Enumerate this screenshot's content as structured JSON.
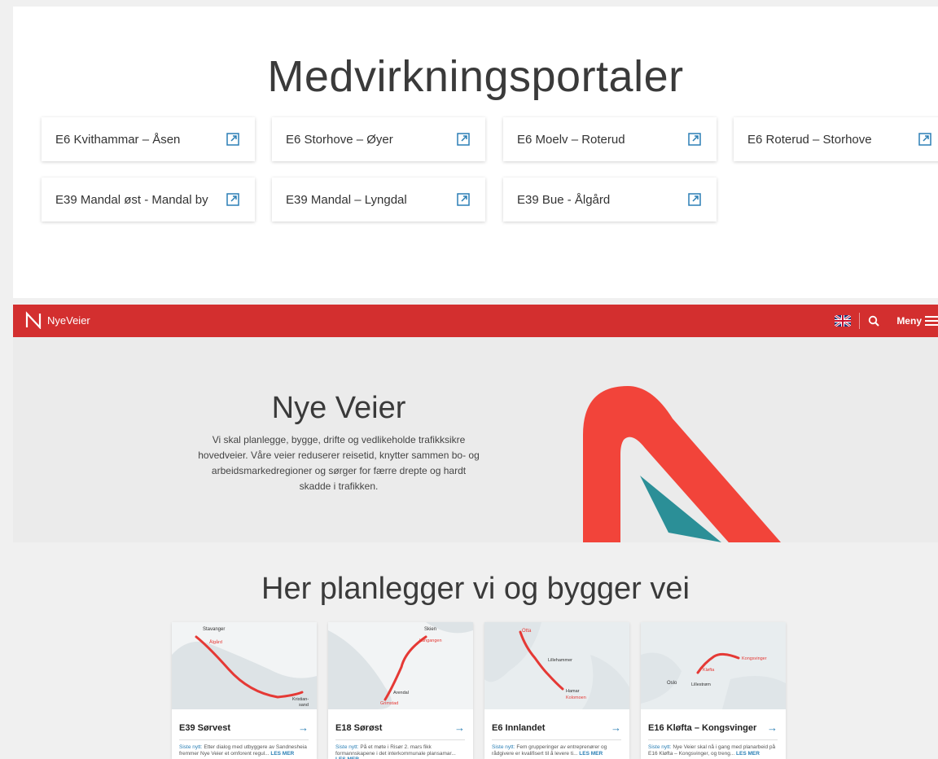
{
  "portals": {
    "title": "Medvirkningsportaler",
    "items": [
      {
        "label": "E6 Kvithammar – Åsen"
      },
      {
        "label": "E6 Storhove – Øyer"
      },
      {
        "label": "E6 Moelv – Roterud"
      },
      {
        "label": "E6 Roterud – Storhove"
      },
      {
        "label": "E39 Mandal øst - Mandal by"
      },
      {
        "label": "E39 Mandal – Lyngdal"
      },
      {
        "label": "E39 Bue - Ålgård"
      }
    ]
  },
  "header": {
    "logo_text": "NyeVeier",
    "menu_label": "Meny",
    "accent": "#d32f2f"
  },
  "hero": {
    "title": "Nye Veier",
    "text": "Vi skal planlegge, bygge, drifte og vedlikeholde trafikksikre hovedveier. Våre veier reduserer reisetid, knytter sammen bo- og arbeidsmarkedregioner og sørger for færre drepte og hardt skadde i trafikken.",
    "logo_red": "#f2443a",
    "logo_teal": "#2b8f97"
  },
  "projects": {
    "title": "Her planlegger vi og bygger vei",
    "news_label": "Siste nytt:",
    "read_more": "LES MER",
    "items": [
      {
        "name": "E39 Sørvest",
        "news": "Etter dialog med utbyggere av Sandnesheia fremmer Nye Veier et omforent regul...",
        "places": [
          "Stavanger",
          "Ålgård",
          "Kristian-",
          "sand"
        ]
      },
      {
        "name": "E18 Sørøst",
        "news": "På et møte i Risør 2. mars fikk formannskapene i det interkommunale plansamar...",
        "places": [
          "Skien",
          "Langangen",
          "Arendal",
          "Grimstad"
        ]
      },
      {
        "name": "E6 Innlandet",
        "news": "Fem grupperinger av entreprenører og rådgivere er kvalifisert til å levere ti...",
        "places": [
          "Otta",
          "Lillehammer",
          "Hamar",
          "Kolomoen"
        ]
      },
      {
        "name": "E16 Kløfta – Kongsvinger",
        "news": "Nye Veier skal nå i gang med planarbeid på E16 Kløfta – Kongsvinger, og treng...",
        "places": [
          "Kongsvinger",
          "Kløfta",
          "Oslo",
          "Lillestrøm"
        ]
      }
    ]
  }
}
